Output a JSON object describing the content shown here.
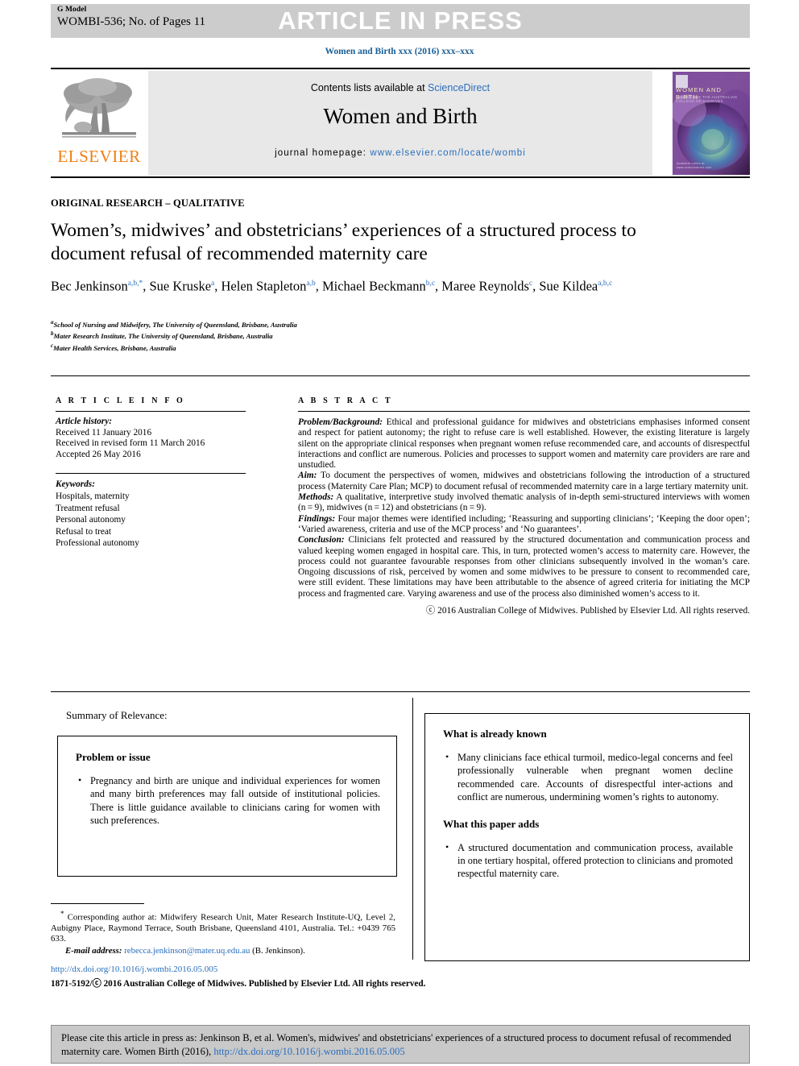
{
  "banner": {
    "g_model": "G Model",
    "running_no": "WOMBI-536; No. of Pages 11",
    "article_in_press": "ARTICLE IN PRESS"
  },
  "journal_citation": "Women and Birth xxx (2016) xxx–xxx",
  "masthead": {
    "contents_prefix": "Contents lists available at ",
    "sciencedirect": "ScienceDirect",
    "journal_title": "Women and Birth",
    "homepage_label": "journal homepage: ",
    "homepage_url": "www.elsevier.com/locate/wombi",
    "publisher": "ELSEVIER",
    "cover_title": "WOMEN AND BIRTH",
    "cover_subtitle": "JOURNAL OF THE AUSTRALIAN COLLEGE OF MIDWIVES",
    "cover_footer": "Available online at\nwww.sciencedirect.com"
  },
  "article": {
    "section_type": "ORIGINAL RESEARCH – QUALITATIVE",
    "title": "Women’s, midwives’ and obstetricians’ experiences of a structured process to document refusal of recommended maternity care",
    "authors": [
      {
        "name": "Bec Jenkinson",
        "sup": "a,b,*",
        "sep": ", "
      },
      {
        "name": "Sue Kruske",
        "sup": "a",
        "sep": ", "
      },
      {
        "name": "Helen Stapleton",
        "sup": "a,b",
        "sep": ", "
      },
      {
        "name": "Michael Beckmann",
        "sup": "b,c",
        "sep": ", "
      },
      {
        "name": "Maree Reynolds",
        "sup": "c",
        "sep": ", "
      },
      {
        "name": "Sue Kildea",
        "sup": "a,b,c",
        "sep": ""
      }
    ],
    "affiliations": [
      {
        "mark": "a",
        "text": "School of Nursing and Midwifery, The University of Queensland, Brisbane, Australia"
      },
      {
        "mark": "b",
        "text": "Mater Research Institute, The University of Queensland, Brisbane, Australia"
      },
      {
        "mark": "c",
        "text": "Mater Health Services, Brisbane, Australia"
      }
    ]
  },
  "article_info": {
    "heading": "A R T I C L E   I N F O",
    "history_label": "Article history:",
    "history": [
      "Received 11 January 2016",
      "Received in revised form 11 March 2016",
      "Accepted 26 May 2016"
    ],
    "keywords_label": "Keywords:",
    "keywords": [
      "Hospitals, maternity",
      "Treatment refusal",
      "Personal autonomy",
      "Refusal to treat",
      "Professional autonomy"
    ]
  },
  "abstract": {
    "heading": "A B S T R A C T",
    "sections": [
      {
        "label": "Problem/Background:",
        "text": " Ethical and professional guidance for midwives and obstetricians emphasises informed consent and respect for patient autonomy; the right to refuse care is well established. However, the existing literature is largely silent on the appropriate clinical responses when pregnant women refuse recommended care, and accounts of disrespectful interactions and conflict are numerous. Policies and processes to support women and maternity care providers are rare and unstudied."
      },
      {
        "label": "Aim:",
        "text": " To document the perspectives of women, midwives and obstetricians following the introduction of a structured process (Maternity Care Plan; MCP) to document refusal of recommended maternity care in a large tertiary maternity unit."
      },
      {
        "label": "Methods:",
        "text": " A qualitative, interpretive study involved thematic analysis of in-depth semi-structured interviews with women (n = 9), midwives (n = 12) and obstetricians (n = 9)."
      },
      {
        "label": "Findings:",
        "text": " Four major themes were identified including; ‘Reassuring and supporting clinicians’; ‘Keeping the door open’; ‘Varied awareness, criteria and use of the MCP process’ and ‘No guarantees’."
      },
      {
        "label": "Conclusion:",
        "text": " Clinicians felt protected and reassured by the structured documentation and communication process and valued keeping women engaged in hospital care. This, in turn, protected women’s access to maternity care. However, the process could not guarantee favourable responses from other clinicians subsequently involved in the woman’s care. Ongoing discussions of risk, perceived by women and some midwives to be pressure to consent to recommended care, were still evident. These limitations may have been attributable to the absence of agreed criteria for initiating the MCP process and fragmented care. Varying awareness and use of the process also diminished women’s access to it."
      }
    ],
    "copyright": "ⓒ 2016 Australian College of Midwives. Published by Elsevier Ltd. All rights reserved."
  },
  "summary_of_relevance": {
    "title": "Summary of Relevance:",
    "left_box": {
      "heading": "Problem or issue",
      "items": [
        "Pregnancy and birth are unique and individual experiences for women and many birth preferences may fall outside of institutional policies. There is little guidance available to clinicians caring for women with such preferences."
      ]
    },
    "right_box": {
      "heading_known": "What is already known",
      "items_known": [
        "Many clinicians face ethical turmoil, medico-legal concerns and feel professionally vulnerable when pregnant women decline recommended care. Accounts of disrespectful inter-actions and conflict are numerous, undermining women’s rights to autonomy."
      ],
      "heading_adds": "What this paper adds",
      "items_adds": [
        "A structured documentation and communication process, available in one tertiary hospital, offered protection to clinicians and promoted respectful maternity care."
      ]
    }
  },
  "footnotes": {
    "corresponding": "Corresponding author at: Midwifery Research Unit, Mater Research Institute-UQ, Level 2, Aubigny Place, Raymond Terrace, South Brisbane, Queensland 4101, Australia. Tel.: +0439 765 633.",
    "email_label": "E-mail address:",
    "email": "rebecca.jenkinson@mater.uq.edu.au",
    "email_owner": "(B. Jenkinson).",
    "doi": "http://dx.doi.org/10.1016/j.wombi.2016.05.005",
    "issn_line": "1871-5192/ⓒ 2016 Australian College of Midwives. Published by Elsevier Ltd. All rights reserved."
  },
  "cite_box": {
    "text_before": "Please cite this article in press as: Jenkinson B, et al. Women's, midwives' and obstetricians' experiences of a structured process to document refusal of recommended maternity care. Women Birth (2016), ",
    "link": "http://dx.doi.org/10.1016/j.wombi.2016.05.005"
  },
  "colors": {
    "link": "#2a6ebb",
    "elsevier_orange": "#f07f13",
    "banner_grey": "#cccccc",
    "masthead_grey": "#e8e8e8",
    "cite_grey": "#c9c9c9"
  }
}
